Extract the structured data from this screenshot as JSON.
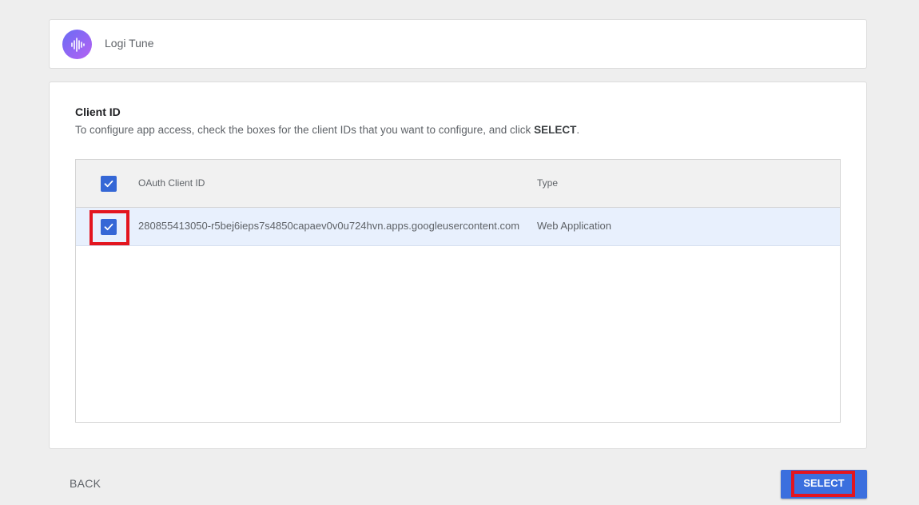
{
  "app": {
    "name": "Logi Tune",
    "icon": "sound-wave-icon",
    "icon_gradient": [
      "#6a6cf4",
      "#b561f3"
    ]
  },
  "client_section": {
    "title": "Client ID",
    "description_prefix": "To configure app access, check the boxes for the client IDs that you want to configure, and click ",
    "description_bold": "SELECT",
    "description_suffix": "."
  },
  "table": {
    "headers": {
      "client_id": "OAuth Client ID",
      "type": "Type"
    },
    "header_checked": true,
    "rows": [
      {
        "checked": true,
        "client_id": "280855413050-r5bej6ieps7s4850capaev0v0u724hvn.apps.googleusercontent.com",
        "type": "Web Application"
      }
    ]
  },
  "footer": {
    "back_label": "BACK",
    "select_label": "SELECT"
  },
  "colors": {
    "accent": "#3b6fde",
    "checkbox": "#3567d6",
    "highlight": "#e3151f",
    "selected_row": "#e8f0fd"
  }
}
